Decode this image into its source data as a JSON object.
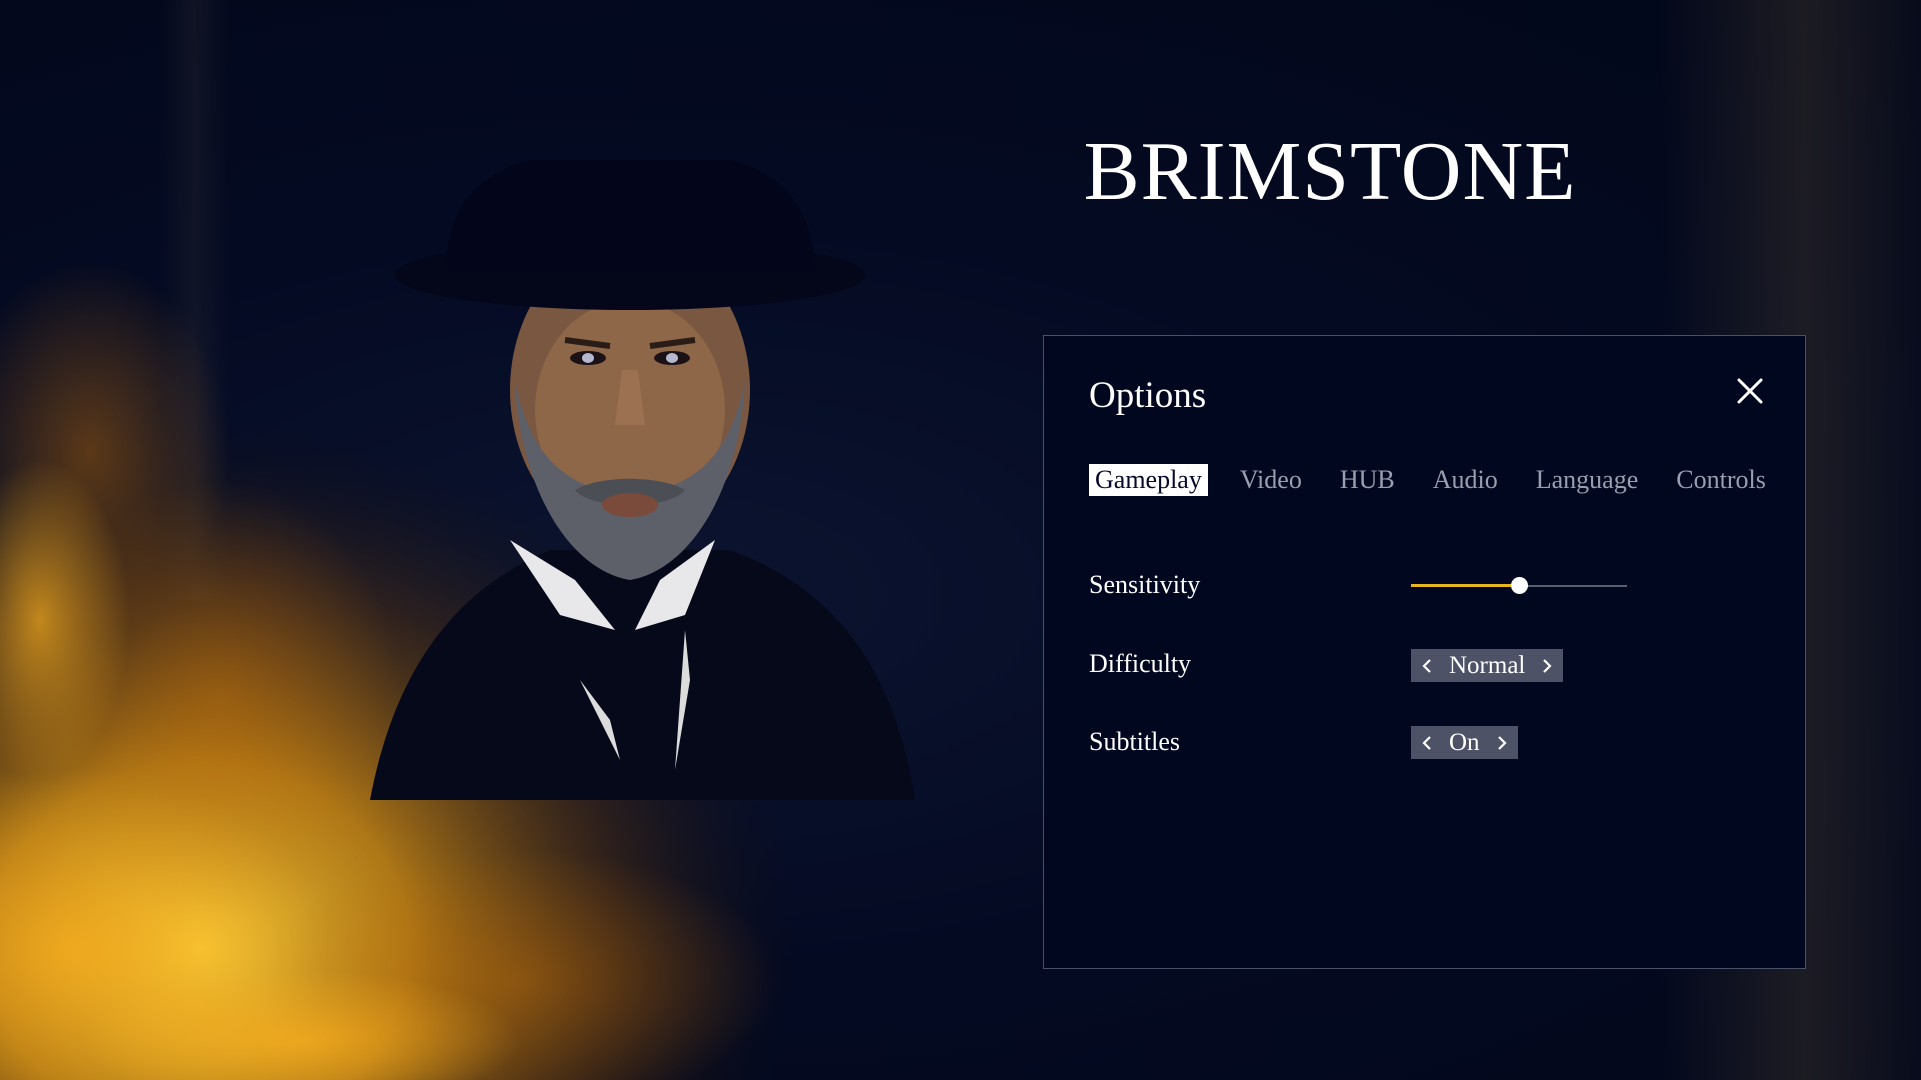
{
  "game": {
    "title": "BRIMSTONE"
  },
  "options": {
    "title": "Options",
    "tabs": [
      {
        "label": "Gameplay",
        "active": true
      },
      {
        "label": "Video",
        "active": false
      },
      {
        "label": "HUB",
        "active": false
      },
      {
        "label": "Audio",
        "active": false
      },
      {
        "label": "Language",
        "active": false
      },
      {
        "label": "Controls",
        "active": false
      }
    ],
    "settings": {
      "sensitivity": {
        "label": "Sensitivity",
        "value_fraction": 0.5
      },
      "difficulty": {
        "label": "Difficulty",
        "value": "Normal"
      },
      "subtitles": {
        "label": "Subtitles",
        "value": "On"
      }
    }
  },
  "colors": {
    "background": "#02081f",
    "panel_border": "#4a5068",
    "slider_accent": "#e7b51d",
    "selector_bg": "#4d5266",
    "tab_inactive": "#9a9eae"
  },
  "icons": {
    "close": "close-icon",
    "prev": "chevron-left-icon",
    "next": "chevron-right-icon"
  }
}
